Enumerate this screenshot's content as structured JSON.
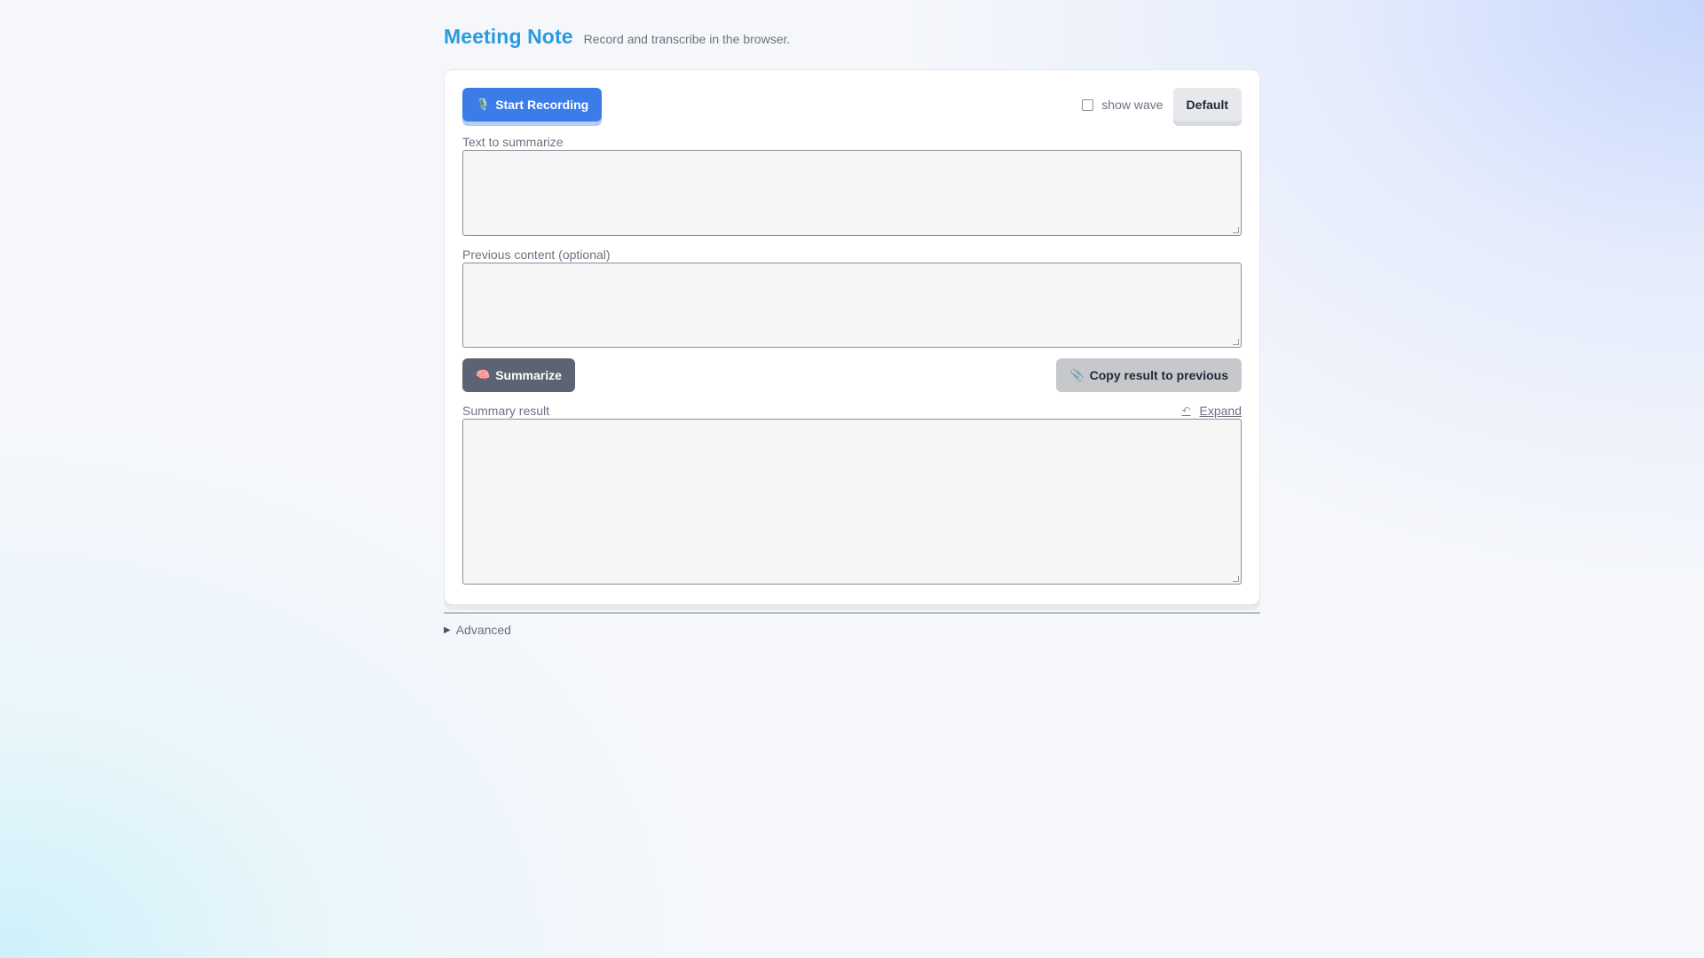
{
  "header": {
    "title": "Meeting Note",
    "subtitle": "Record and transcribe in the browser."
  },
  "toolbar": {
    "record_icon": "🎙️",
    "record_label": "Start Recording",
    "show_wave_label": "show wave",
    "show_wave_checked": false,
    "default_label": "Default"
  },
  "fields": {
    "text_label": "Text to summarize",
    "text_value": "",
    "previous_label": "Previous content (optional)",
    "previous_value": ""
  },
  "actions": {
    "summarize_icon": "🧠",
    "summarize_label": "Summarize",
    "copy_icon": "📎",
    "copy_label": "Copy result to previous"
  },
  "result": {
    "label": "Summary result",
    "expand_icon": "↶",
    "expand_label": "Expand",
    "value": ""
  },
  "advanced": {
    "label": "Advanced",
    "expanded": false
  },
  "colors": {
    "accent": "#2a9ae0",
    "primary_button": "#3b7ce8",
    "summarize_button": "#5c6473"
  }
}
